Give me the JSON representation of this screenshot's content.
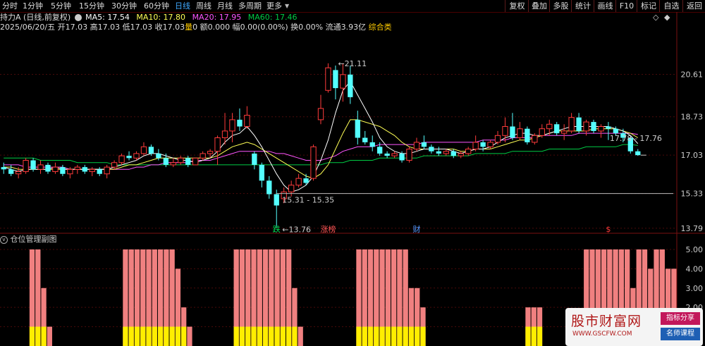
{
  "toolbar": {
    "tabs": [
      "分时",
      "1分钟",
      "5分钟",
      "15分钟",
      "30分钟",
      "60分钟",
      "日线",
      "周线",
      "月线",
      "多周期",
      "更多"
    ],
    "active": "日线",
    "right_buttons": [
      "复权",
      "叠加",
      "多股",
      "统计",
      "画线",
      "F10",
      "标记",
      "自选",
      "返回"
    ]
  },
  "ma_line": {
    "title": "持力A",
    "subtitle": "(日线,前复权)",
    "ma5": "MA5: 17.54",
    "ma10": "MA10: 17.80",
    "ma20": "MA20: 17.95",
    "ma60": "MA60: 17.46",
    "colors": {
      "ma5": "#ffffff",
      "ma10": "#ffff55",
      "ma20": "#ff55ff",
      "ma60": "#00cc44"
    }
  },
  "info_line": {
    "date": "2025/06/20/五",
    "open": "开17.03",
    "high": "高17.03",
    "low": "低17.03",
    "close": "收17.03",
    "vol_label": "量",
    "vol": "0",
    "amt": "额0.000",
    "chg": "幅0.00(0.00%)",
    "turn": "换0.00%",
    "float": "流通3.93亿",
    "extra": "综合类"
  },
  "chart_data": {
    "type": "candlestick",
    "y_ticks": [
      "20.61",
      "18.73",
      "17.03",
      "15.33",
      "13.79"
    ],
    "ylim": [
      13.6,
      22.5
    ],
    "last_price": 17.03,
    "annotations": {
      "high_label": "21.11",
      "low_label": "13.76",
      "range_label": "15.31 - 15.35",
      "right_range_label": "17.78 - 17.76",
      "signals": [
        "跌",
        "涨榜",
        "财",
        "$"
      ]
    },
    "candles": [
      {
        "o": 16.5,
        "h": 16.7,
        "l": 16.2,
        "c": 16.4
      },
      {
        "o": 16.4,
        "h": 16.6,
        "l": 16.1,
        "c": 16.2
      },
      {
        "o": 16.2,
        "h": 16.5,
        "l": 16.0,
        "c": 16.3
      },
      {
        "o": 16.3,
        "h": 16.9,
        "l": 16.2,
        "c": 16.8
      },
      {
        "o": 16.8,
        "h": 16.9,
        "l": 16.3,
        "c": 16.4
      },
      {
        "o": 16.4,
        "h": 16.8,
        "l": 16.2,
        "c": 16.6
      },
      {
        "o": 16.6,
        "h": 16.7,
        "l": 16.2,
        "c": 16.3
      },
      {
        "o": 16.3,
        "h": 16.7,
        "l": 16.2,
        "c": 16.5
      },
      {
        "o": 16.5,
        "h": 16.6,
        "l": 16.1,
        "c": 16.2
      },
      {
        "o": 16.2,
        "h": 16.5,
        "l": 16.0,
        "c": 16.4
      },
      {
        "o": 16.4,
        "h": 16.6,
        "l": 16.2,
        "c": 16.5
      },
      {
        "o": 16.5,
        "h": 16.6,
        "l": 16.2,
        "c": 16.3
      },
      {
        "o": 16.3,
        "h": 16.5,
        "l": 16.1,
        "c": 16.4
      },
      {
        "o": 16.4,
        "h": 16.5,
        "l": 16.1,
        "c": 16.2
      },
      {
        "o": 16.2,
        "h": 16.6,
        "l": 16.0,
        "c": 16.5
      },
      {
        "o": 16.5,
        "h": 16.8,
        "l": 16.4,
        "c": 16.7
      },
      {
        "o": 16.7,
        "h": 17.1,
        "l": 16.6,
        "c": 17.0
      },
      {
        "o": 17.0,
        "h": 17.2,
        "l": 16.8,
        "c": 16.9
      },
      {
        "o": 16.9,
        "h": 17.2,
        "l": 16.8,
        "c": 17.1
      },
      {
        "o": 17.1,
        "h": 17.6,
        "l": 17.0,
        "c": 17.4
      },
      {
        "o": 17.4,
        "h": 17.5,
        "l": 17.0,
        "c": 17.1
      },
      {
        "o": 17.1,
        "h": 17.3,
        "l": 16.8,
        "c": 16.9
      },
      {
        "o": 16.9,
        "h": 17.1,
        "l": 16.5,
        "c": 16.6
      },
      {
        "o": 16.6,
        "h": 16.9,
        "l": 16.5,
        "c": 16.7
      },
      {
        "o": 16.7,
        "h": 17.0,
        "l": 16.6,
        "c": 16.9
      },
      {
        "o": 16.9,
        "h": 17.0,
        "l": 16.5,
        "c": 16.6
      },
      {
        "o": 16.6,
        "h": 16.9,
        "l": 16.6,
        "c": 16.9
      },
      {
        "o": 16.9,
        "h": 17.2,
        "l": 16.8,
        "c": 17.1
      },
      {
        "o": 17.1,
        "h": 17.3,
        "l": 16.9,
        "c": 17.2
      },
      {
        "o": 17.2,
        "h": 17.9,
        "l": 16.6,
        "c": 17.8
      },
      {
        "o": 17.8,
        "h": 18.9,
        "l": 17.5,
        "c": 18.1
      },
      {
        "o": 18.1,
        "h": 18.9,
        "l": 17.6,
        "c": 18.6
      },
      {
        "o": 18.6,
        "h": 19.1,
        "l": 18.1,
        "c": 18.3
      },
      {
        "o": 18.3,
        "h": 19.2,
        "l": 18.2,
        "c": 18.8
      },
      {
        "o": 17.1,
        "h": 17.2,
        "l": 16.4,
        "c": 16.6
      },
      {
        "o": 16.6,
        "h": 16.7,
        "l": 15.6,
        "c": 15.9
      },
      {
        "o": 15.9,
        "h": 16.1,
        "l": 15.1,
        "c": 15.3
      },
      {
        "o": 15.3,
        "h": 15.5,
        "l": 13.8,
        "c": 14.8
      },
      {
        "o": 15.1,
        "h": 15.6,
        "l": 14.9,
        "c": 15.4
      },
      {
        "o": 15.4,
        "h": 15.9,
        "l": 15.2,
        "c": 15.7
      },
      {
        "o": 15.7,
        "h": 16.2,
        "l": 15.6,
        "c": 16.0
      },
      {
        "o": 16.0,
        "h": 16.2,
        "l": 15.7,
        "c": 15.8
      },
      {
        "o": 16.0,
        "h": 17.5,
        "l": 15.9,
        "c": 17.4
      },
      {
        "o": 18.6,
        "h": 19.7,
        "l": 18.4,
        "c": 19.1
      },
      {
        "o": 19.9,
        "h": 21.1,
        "l": 19.8,
        "c": 20.9
      },
      {
        "o": 20.8,
        "h": 21.0,
        "l": 19.5,
        "c": 20.0
      },
      {
        "o": 20.0,
        "h": 21.1,
        "l": 19.4,
        "c": 20.6
      },
      {
        "o": 20.6,
        "h": 21.0,
        "l": 19.3,
        "c": 19.6
      },
      {
        "o": 18.6,
        "h": 19.0,
        "l": 17.5,
        "c": 17.8
      },
      {
        "o": 17.8,
        "h": 18.1,
        "l": 17.5,
        "c": 17.6
      },
      {
        "o": 17.6,
        "h": 17.9,
        "l": 17.2,
        "c": 17.4
      },
      {
        "o": 17.4,
        "h": 17.6,
        "l": 17.0,
        "c": 17.1
      },
      {
        "o": 17.1,
        "h": 17.2,
        "l": 16.9,
        "c": 17.0
      },
      {
        "o": 17.0,
        "h": 17.2,
        "l": 16.9,
        "c": 17.1
      },
      {
        "o": 17.1,
        "h": 17.2,
        "l": 16.7,
        "c": 16.8
      },
      {
        "o": 16.8,
        "h": 17.4,
        "l": 16.7,
        "c": 17.3
      },
      {
        "o": 17.3,
        "h": 17.8,
        "l": 17.2,
        "c": 17.6
      },
      {
        "o": 17.6,
        "h": 17.9,
        "l": 17.3,
        "c": 17.4
      },
      {
        "o": 17.4,
        "h": 17.5,
        "l": 17.1,
        "c": 17.2
      },
      {
        "o": 17.2,
        "h": 17.4,
        "l": 17.0,
        "c": 17.1
      },
      {
        "o": 17.1,
        "h": 17.3,
        "l": 17.0,
        "c": 17.2
      },
      {
        "o": 17.2,
        "h": 17.3,
        "l": 16.9,
        "c": 17.0
      },
      {
        "o": 17.0,
        "h": 17.2,
        "l": 16.9,
        "c": 17.1
      },
      {
        "o": 17.1,
        "h": 17.4,
        "l": 17.0,
        "c": 17.3
      },
      {
        "o": 17.3,
        "h": 17.9,
        "l": 17.2,
        "c": 17.6
      },
      {
        "o": 17.6,
        "h": 17.7,
        "l": 17.2,
        "c": 17.4
      },
      {
        "o": 17.4,
        "h": 17.7,
        "l": 17.3,
        "c": 17.6
      },
      {
        "o": 17.6,
        "h": 18.1,
        "l": 17.5,
        "c": 17.9
      },
      {
        "o": 17.9,
        "h": 18.7,
        "l": 17.6,
        "c": 18.3
      },
      {
        "o": 18.3,
        "h": 18.9,
        "l": 17.7,
        "c": 17.8
      },
      {
        "o": 17.8,
        "h": 18.5,
        "l": 17.7,
        "c": 18.2
      },
      {
        "o": 18.2,
        "h": 18.3,
        "l": 17.5,
        "c": 17.6
      },
      {
        "o": 17.6,
        "h": 18.0,
        "l": 17.5,
        "c": 17.9
      },
      {
        "o": 17.9,
        "h": 18.4,
        "l": 17.8,
        "c": 18.2
      },
      {
        "o": 18.2,
        "h": 18.6,
        "l": 17.9,
        "c": 18.4
      },
      {
        "o": 18.4,
        "h": 18.5,
        "l": 17.9,
        "c": 18.0
      },
      {
        "o": 18.0,
        "h": 18.4,
        "l": 17.7,
        "c": 18.1
      },
      {
        "o": 18.1,
        "h": 18.9,
        "l": 18.0,
        "c": 18.7
      },
      {
        "o": 18.7,
        "h": 18.9,
        "l": 18.0,
        "c": 18.1
      },
      {
        "o": 18.1,
        "h": 18.6,
        "l": 17.9,
        "c": 18.5
      },
      {
        "o": 18.5,
        "h": 18.6,
        "l": 18.0,
        "c": 18.1
      },
      {
        "o": 18.1,
        "h": 18.4,
        "l": 17.8,
        "c": 18.3
      },
      {
        "o": 18.3,
        "h": 18.5,
        "l": 17.7,
        "c": 18.2
      },
      {
        "o": 18.2,
        "h": 18.3,
        "l": 17.9,
        "c": 18.0
      },
      {
        "o": 18.0,
        "h": 18.2,
        "l": 17.6,
        "c": 17.8
      },
      {
        "o": 17.8,
        "h": 17.9,
        "l": 17.1,
        "c": 17.2
      },
      {
        "o": 17.2,
        "h": 17.3,
        "l": 17.0,
        "c": 17.03
      }
    ],
    "ma": {
      "ma5": [
        16.5,
        16.4,
        16.3,
        16.4,
        16.4,
        16.4,
        16.4,
        16.5,
        16.4,
        16.4,
        16.4,
        16.4,
        16.4,
        16.4,
        16.4,
        16.5,
        16.6,
        16.7,
        16.8,
        17.0,
        17.1,
        17.1,
        17.0,
        16.9,
        16.8,
        16.8,
        16.7,
        16.8,
        16.9,
        17.2,
        17.6,
        17.9,
        18.0,
        18.3,
        17.9,
        17.4,
        16.8,
        16.2,
        15.7,
        15.4,
        15.5,
        15.7,
        16.1,
        16.8,
        17.7,
        18.9,
        19.9,
        20.3,
        19.7,
        19.1,
        18.5,
        17.8,
        17.4,
        17.2,
        17.1,
        17.1,
        17.2,
        17.3,
        17.3,
        17.3,
        17.3,
        17.2,
        17.1,
        17.2,
        17.3,
        17.3,
        17.4,
        17.6,
        17.8,
        17.9,
        18.0,
        18.0,
        17.9,
        17.9,
        18.0,
        18.1,
        18.2,
        18.3,
        18.3,
        18.3,
        18.3,
        18.3,
        18.3,
        18.2,
        18.1,
        17.9,
        17.54
      ],
      "ma10": [
        16.5,
        16.5,
        16.4,
        16.4,
        16.4,
        16.4,
        16.4,
        16.4,
        16.4,
        16.4,
        16.4,
        16.4,
        16.4,
        16.4,
        16.4,
        16.4,
        16.5,
        16.6,
        16.6,
        16.7,
        16.8,
        16.9,
        16.9,
        16.9,
        16.9,
        16.9,
        16.9,
        16.9,
        16.9,
        17.0,
        17.2,
        17.4,
        17.5,
        17.6,
        17.5,
        17.3,
        17.1,
        16.9,
        16.7,
        16.5,
        16.3,
        16.1,
        16.0,
        16.2,
        16.6,
        17.3,
        18.0,
        18.6,
        18.6,
        18.5,
        18.4,
        18.3,
        18.1,
        17.9,
        17.6,
        17.4,
        17.3,
        17.3,
        17.3,
        17.3,
        17.3,
        17.3,
        17.2,
        17.2,
        17.3,
        17.3,
        17.3,
        17.4,
        17.5,
        17.6,
        17.7,
        17.7,
        17.8,
        17.9,
        18.0,
        18.1,
        18.1,
        18.1,
        18.1,
        18.1,
        18.2,
        18.2,
        18.2,
        18.2,
        18.1,
        18.0,
        17.8
      ],
      "ma20": [
        16.6,
        16.6,
        16.6,
        16.5,
        16.5,
        16.5,
        16.5,
        16.5,
        16.5,
        16.4,
        16.4,
        16.4,
        16.4,
        16.4,
        16.4,
        16.4,
        16.4,
        16.4,
        16.5,
        16.5,
        16.6,
        16.6,
        16.7,
        16.7,
        16.7,
        16.7,
        16.8,
        16.8,
        16.8,
        16.9,
        17.0,
        17.1,
        17.2,
        17.2,
        17.2,
        17.2,
        17.2,
        17.1,
        17.1,
        17.0,
        16.9,
        16.8,
        16.8,
        16.8,
        16.9,
        17.0,
        17.2,
        17.3,
        17.4,
        17.4,
        17.4,
        17.5,
        17.5,
        17.5,
        17.5,
        17.5,
        17.5,
        17.6,
        17.6,
        17.6,
        17.6,
        17.6,
        17.6,
        17.6,
        17.6,
        17.7,
        17.7,
        17.7,
        17.7,
        17.8,
        17.8,
        17.8,
        17.8,
        17.9,
        17.9,
        17.9,
        17.9,
        17.9,
        18.0,
        18.0,
        18.0,
        18.0,
        18.0,
        18.0,
        18.0,
        18.0,
        17.95
      ],
      "ma60": [
        16.9,
        16.9,
        16.9,
        16.9,
        16.9,
        16.8,
        16.8,
        16.8,
        16.8,
        16.8,
        16.7,
        16.7,
        16.7,
        16.7,
        16.7,
        16.6,
        16.6,
        16.6,
        16.6,
        16.6,
        16.6,
        16.6,
        16.6,
        16.6,
        16.6,
        16.6,
        16.6,
        16.6,
        16.6,
        16.6,
        16.6,
        16.6,
        16.6,
        16.6,
        16.6,
        16.6,
        16.6,
        16.6,
        16.6,
        16.6,
        16.6,
        16.6,
        16.6,
        16.6,
        16.7,
        16.7,
        16.7,
        16.8,
        16.8,
        16.8,
        16.8,
        16.9,
        16.9,
        16.9,
        16.9,
        16.9,
        16.9,
        17.0,
        17.0,
        17.0,
        17.0,
        17.0,
        17.0,
        17.0,
        17.1,
        17.1,
        17.1,
        17.1,
        17.1,
        17.2,
        17.2,
        17.2,
        17.2,
        17.2,
        17.3,
        17.3,
        17.3,
        17.3,
        17.3,
        17.4,
        17.4,
        17.4,
        17.4,
        17.4,
        17.5,
        17.5,
        17.46
      ]
    }
  },
  "sub_chart": {
    "title": "仓位管理副图",
    "y_ticks": [
      "5.00",
      "4.00",
      "3.00",
      "2.00",
      "1.00"
    ],
    "ylim": [
      0,
      5.4
    ],
    "pink": [
      0,
      0,
      0,
      0,
      0,
      5,
      5,
      3,
      1,
      0,
      0,
      0,
      0,
      0,
      0,
      0,
      0,
      0,
      0,
      0,
      0,
      5,
      5,
      5,
      5,
      5,
      5,
      5,
      5,
      5,
      4,
      2,
      1,
      0,
      0,
      0,
      0,
      0,
      0,
      0,
      5,
      5,
      5,
      5,
      5,
      5,
      5,
      5,
      5,
      5,
      3,
      1,
      0,
      0,
      0,
      0,
      0,
      0,
      0,
      0,
      0,
      5,
      5,
      5,
      5,
      5,
      5,
      5,
      5,
      5,
      3,
      3,
      2,
      0,
      0,
      0,
      0,
      0,
      0,
      0,
      0,
      0,
      0,
      0,
      0,
      0,
      0,
      0,
      0,
      0,
      2,
      2,
      2,
      0,
      0,
      0,
      0,
      0,
      0,
      0,
      5,
      5,
      5,
      5,
      5,
      5,
      5,
      5,
      3,
      5,
      5,
      4,
      5,
      5,
      4,
      4
    ],
    "yellow": [
      0,
      0,
      0,
      0,
      0,
      1,
      1,
      1,
      0,
      0,
      0,
      0,
      0,
      0,
      0,
      0,
      0,
      0,
      0,
      0,
      0,
      1,
      1,
      1,
      1,
      1,
      1,
      1,
      1,
      1,
      1,
      1,
      0,
      0,
      0,
      0,
      0,
      0,
      0,
      0,
      1,
      1,
      1,
      1,
      1,
      1,
      1,
      1,
      1,
      1,
      1,
      0,
      0,
      0,
      0,
      0,
      0,
      0,
      0,
      0,
      0,
      1,
      1,
      1,
      1,
      1,
      1,
      1,
      1,
      1,
      1,
      1,
      1,
      0,
      0,
      0,
      0,
      0,
      0,
      0,
      0,
      0,
      0,
      0,
      0,
      0,
      0,
      0,
      0,
      0,
      1,
      1,
      1,
      0,
      0,
      0,
      0,
      0,
      0,
      0,
      1,
      1,
      1,
      1,
      1,
      1,
      1,
      1,
      1,
      1,
      1,
      1,
      1,
      1,
      1,
      1
    ]
  },
  "watermark": {
    "site": "股市财富网",
    "url": "WWW.GSCFW.COM",
    "badge1": "指标分享",
    "badge2": "名师课程"
  }
}
